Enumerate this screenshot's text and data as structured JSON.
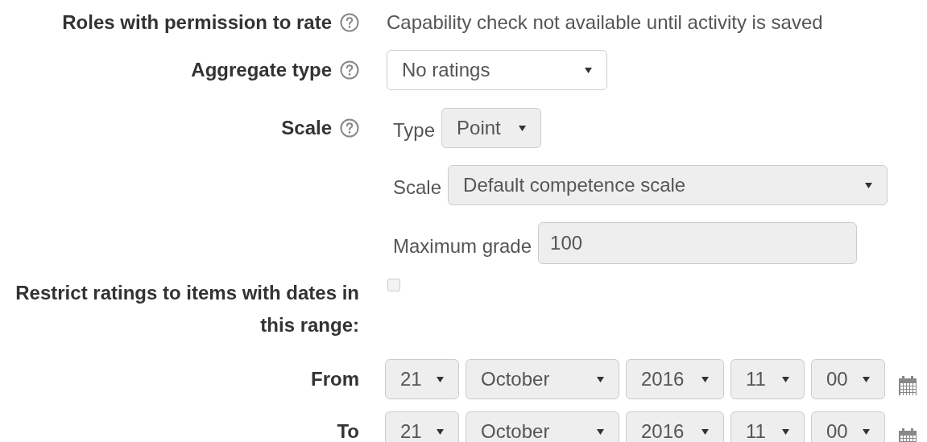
{
  "fields": [
    {
      "kind": "text",
      "label": "Roles with permission to rate",
      "help": true,
      "text": "Capability check not available until activity is saved"
    },
    {
      "kind": "select",
      "label": "Aggregate type",
      "help": true,
      "value": "No ratings",
      "disabled": false
    },
    {
      "kind": "group",
      "label": "Scale",
      "help": true,
      "subfields": [
        {
          "kind": "select",
          "label": "Type",
          "value": "Point",
          "disabled": true
        },
        {
          "kind": "select",
          "label": "Scale",
          "value": "Default competence scale",
          "disabled": true
        },
        {
          "kind": "input",
          "label": "Maximum grade",
          "value": "100",
          "disabled": true
        }
      ]
    },
    {
      "kind": "checkbox",
      "label": "Restrict ratings to items with dates in this range:",
      "checked": false
    },
    {
      "kind": "date",
      "label": "From",
      "disabled": true,
      "parts": [
        "21",
        "October",
        "2016",
        "11",
        "00"
      ]
    },
    {
      "kind": "date",
      "label": "To",
      "disabled": true,
      "parts": [
        "21",
        "October",
        "2016",
        "11",
        "00"
      ]
    }
  ]
}
